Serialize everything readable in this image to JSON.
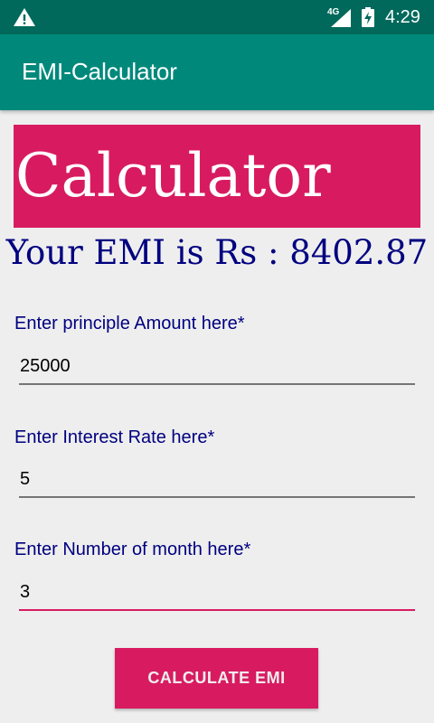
{
  "status_bar": {
    "time": "4:29",
    "network": "4G",
    "icons": [
      "warning-icon",
      "signal-icon",
      "battery-charging-icon"
    ]
  },
  "app_bar": {
    "title": "EMI-Calculator"
  },
  "banner": {
    "text": "Calculator"
  },
  "result": {
    "text": "Your EMI is Rs : 8402.87"
  },
  "form": {
    "principal": {
      "label": "Enter principle Amount here*",
      "value": "25000"
    },
    "interest": {
      "label": "Enter Interest Rate here*",
      "value": "5"
    },
    "months": {
      "label": "Enter Number of month here*",
      "value": "3"
    }
  },
  "button": {
    "label": "CALCULATE EMI"
  },
  "colors": {
    "status_bar": "#00695C",
    "app_bar": "#00897B",
    "accent": "#D81B60",
    "label_text": "#000080",
    "background": "#EEEEEE"
  }
}
